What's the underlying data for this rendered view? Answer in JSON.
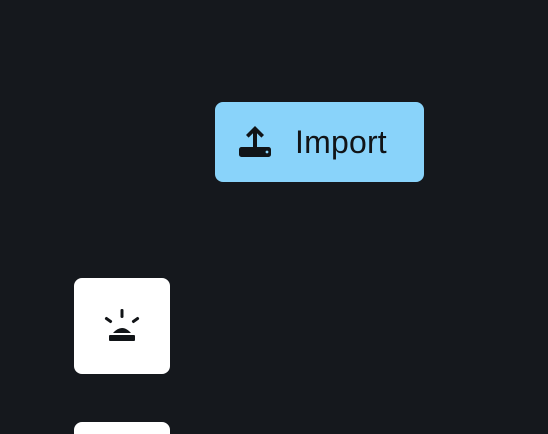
{
  "import_button": {
    "label": "Import",
    "icon": "upload-tray-icon",
    "background": "#89d3fa"
  },
  "tiles": [
    {
      "icon": "siren-alarm-icon",
      "background": "#ffffff"
    },
    {
      "icon": "",
      "background": "#ffffff"
    }
  ],
  "colors": {
    "page_background": "#15181d",
    "icon": "#111417"
  }
}
